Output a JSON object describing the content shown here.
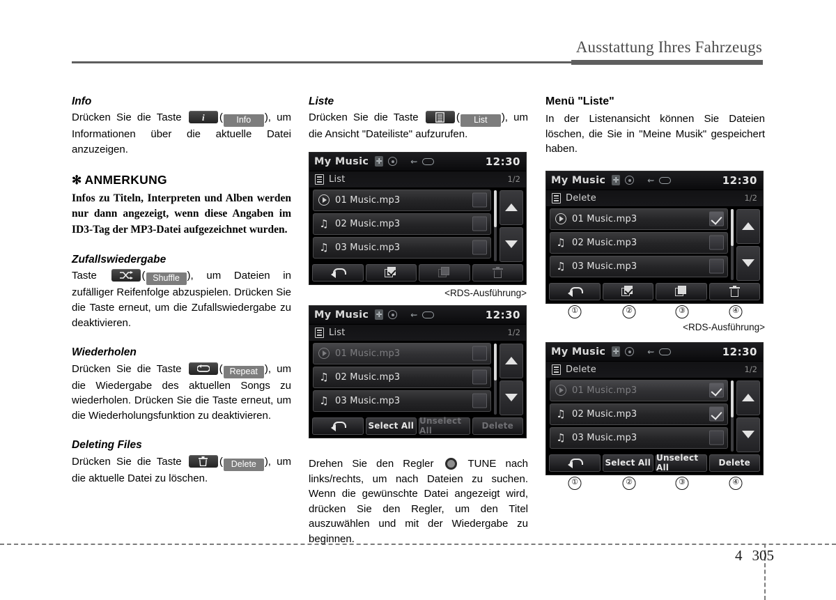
{
  "page": {
    "header_title": "Ausstattung Ihres Fahrzeugs",
    "chapter": "4",
    "folio": "305"
  },
  "left_column": {
    "info": {
      "heading": "Info",
      "text_before": "Drücken Sie die Taste",
      "key_icon": "info-i-icon",
      "key_label": "Info",
      "text_after": "um Informationen über die aktuelle Datei anzuzeigen."
    },
    "note": {
      "star": "✻",
      "heading": "ANMERKUNG",
      "body": "Infos zu Titeln, Interpreten und Alben werden nur dann angezeigt, wenn diese Angaben im ID3-Tag der MP3-Datei aufgezeichnet wurden."
    },
    "shuffle": {
      "heading": "Zufallswiedergabe",
      "text_before": "Taste",
      "key_icon": "shuffle-icon",
      "key_label": "Shuffle",
      "text_after": "um Dateien in zufälliger Reifenfolge abzuspielen. Drücken Sie die Taste erneut, um die Zufallswiedergabe zu deaktivieren."
    },
    "repeat": {
      "heading": "Wiederholen",
      "text_before": "Drücken Sie die Taste",
      "key_icon": "repeat-icon",
      "key_label": "Repeat",
      "text_after": "um die Wiedergabe des aktuellen Songs zu wiederholen. Drücken Sie die Taste erneut, um die Wiederholungsfunktion zu deaktivieren."
    },
    "deleting": {
      "heading": "Deleting Files",
      "text_before": "Drücken Sie die Taste",
      "key_icon": "trash-icon",
      "key_label": "Delete",
      "text_after": "um die aktuelle Datei zu löschen."
    }
  },
  "middle_column": {
    "liste": {
      "heading": "Liste",
      "text_before": "Drücken Sie die Taste",
      "key_icon": "list-icon",
      "key_label": "List",
      "text_after": "um die Ansicht \"Dateiliste\" aufzurufen."
    },
    "caption_rds": "<RDS-Ausführung>",
    "tune_text_1": "Drehen Sie den Regler",
    "tune_knob_icon": "tune-knob-icon",
    "tune_text_2": "TUNE nach links/rechts, um nach Dateien zu suchen. Wenn die gewünschte Datei angezeigt wird, drücken Sie den Regler, um den Titel auszuwählen und mit der Wiedergabe zu beginnen."
  },
  "right_column": {
    "heading": "Menü \"Liste\"",
    "body": "In der Listenansicht können Sie Dateien löschen, die Sie in \"Meine Musik\" gespeichert haben.",
    "caption_rds": "<RDS-Ausführung>",
    "callouts": [
      "①",
      "②",
      "③",
      "④"
    ]
  },
  "devices": {
    "status": {
      "source": "My Music",
      "clock": "12:30",
      "icons": [
        "bluetooth-icon",
        "disc-icon",
        "usb-icon",
        "aux-icon"
      ]
    },
    "screen_list_a": {
      "title": "List",
      "page_indicator": "1/2",
      "rows": [
        {
          "name": "01 Music.mp3",
          "icon": "play-circle-icon",
          "dimmed": false,
          "checked": false
        },
        {
          "name": "02 Music.mp3",
          "icon": "music-note-icon",
          "dimmed": false,
          "checked": false
        },
        {
          "name": "03 Music.mp3",
          "icon": "music-note-icon",
          "dimmed": false,
          "checked": false
        }
      ],
      "footer": [
        {
          "kind": "icon",
          "icon": "back-arrow-icon",
          "label": "",
          "disabled": false
        },
        {
          "kind": "icon",
          "icon": "select-sheet-check-icon",
          "label": "",
          "disabled": false
        },
        {
          "kind": "icon",
          "icon": "unselect-sheet-icon",
          "label": "",
          "disabled": true
        },
        {
          "kind": "icon",
          "icon": "trash-icon",
          "label": "",
          "disabled": true
        }
      ]
    },
    "screen_list_b": {
      "title": "List",
      "page_indicator": "1/2",
      "rows": [
        {
          "name": "01 Music.mp3",
          "icon": "play-circle-icon",
          "dimmed": true,
          "checked": false
        },
        {
          "name": "02 Music.mp3",
          "icon": "music-note-icon",
          "dimmed": false,
          "checked": false
        },
        {
          "name": "03 Music.mp3",
          "icon": "music-note-icon",
          "dimmed": false,
          "checked": false
        }
      ],
      "footer": [
        {
          "kind": "icon",
          "icon": "back-arrow-icon",
          "label": "",
          "disabled": false
        },
        {
          "kind": "text",
          "icon": "",
          "label": "Select All",
          "disabled": false
        },
        {
          "kind": "text",
          "icon": "",
          "label": "Unselect All",
          "disabled": true
        },
        {
          "kind": "text",
          "icon": "",
          "label": "Delete",
          "disabled": true
        }
      ]
    },
    "screen_delete_a": {
      "title": "Delete",
      "page_indicator": "1/2",
      "rows": [
        {
          "name": "01 Music.mp3",
          "icon": "play-circle-icon",
          "dimmed": false,
          "checked": true
        },
        {
          "name": "02 Music.mp3",
          "icon": "music-note-icon",
          "dimmed": false,
          "checked": false
        },
        {
          "name": "03 Music.mp3",
          "icon": "music-note-icon",
          "dimmed": false,
          "checked": false
        }
      ],
      "footer": [
        {
          "kind": "icon",
          "icon": "back-arrow-icon",
          "label": "",
          "disabled": false
        },
        {
          "kind": "icon",
          "icon": "select-sheet-check-icon",
          "label": "",
          "disabled": false
        },
        {
          "kind": "icon",
          "icon": "unselect-sheet-icon",
          "label": "",
          "disabled": false
        },
        {
          "kind": "icon",
          "icon": "trash-icon",
          "label": "",
          "disabled": false
        }
      ]
    },
    "screen_delete_b": {
      "title": "Delete",
      "page_indicator": "1/2",
      "rows": [
        {
          "name": "01 Music.mp3",
          "icon": "play-circle-icon",
          "dimmed": true,
          "checked": true
        },
        {
          "name": "02 Music.mp3",
          "icon": "music-note-icon",
          "dimmed": false,
          "checked": true
        },
        {
          "name": "03 Music.mp3",
          "icon": "music-note-icon",
          "dimmed": false,
          "checked": false
        }
      ],
      "footer": [
        {
          "kind": "icon",
          "icon": "back-arrow-icon",
          "label": "",
          "disabled": false
        },
        {
          "kind": "text",
          "icon": "",
          "label": "Select All",
          "disabled": false
        },
        {
          "kind": "text",
          "icon": "",
          "label": "Unselect All",
          "disabled": false
        },
        {
          "kind": "text",
          "icon": "",
          "label": "Delete",
          "disabled": false
        }
      ]
    }
  },
  "colors": {
    "header_rule": "#5e5e5e",
    "key_button_bg": "#2a2a2a",
    "label_button_bg": "#7d7d7d",
    "screen_bg": "#000000"
  }
}
